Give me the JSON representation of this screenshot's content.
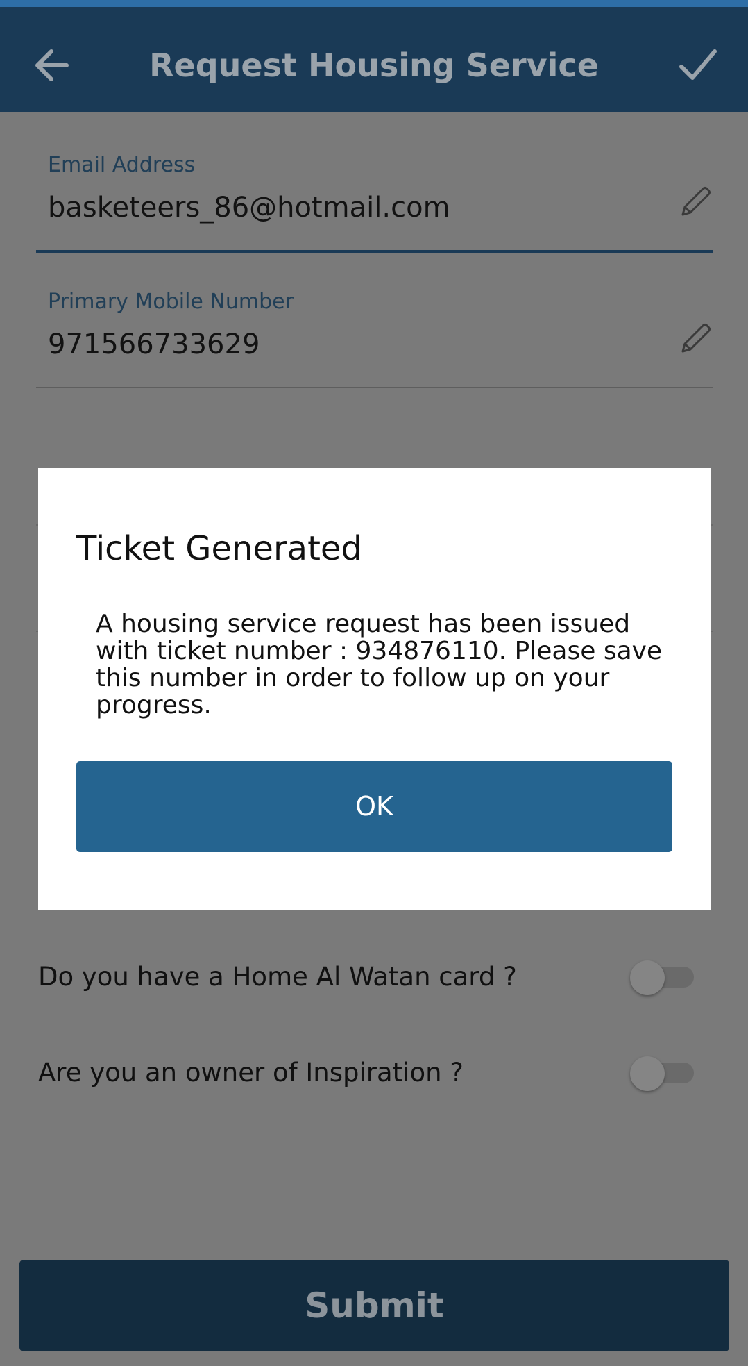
{
  "header": {
    "title": "Request Housing Service",
    "back_icon": "arrow-left-icon",
    "confirm_icon": "checkmark-icon",
    "background": "#1a3a56"
  },
  "form": {
    "email": {
      "label": "Email Address",
      "value": "basketeers_86@hotmail.com",
      "edit_icon": "pencil-icon"
    },
    "mobile": {
      "label": "Primary Mobile Number",
      "value": "971566733629",
      "edit_icon": "pencil-icon"
    },
    "questions": [
      {
        "label": "Do you have a Home Al Watan card ?",
        "enabled": false
      },
      {
        "label": "Are you an owner of Inspiration ?",
        "enabled": false
      }
    ],
    "submit_label": "Submit"
  },
  "dialog": {
    "title": "Ticket Generated",
    "message": "A housing service request has been issued with ticket number : 934876110. Please save this number in order to follow up on your progress.",
    "ok_label": "OK",
    "button_color": "#256490"
  }
}
